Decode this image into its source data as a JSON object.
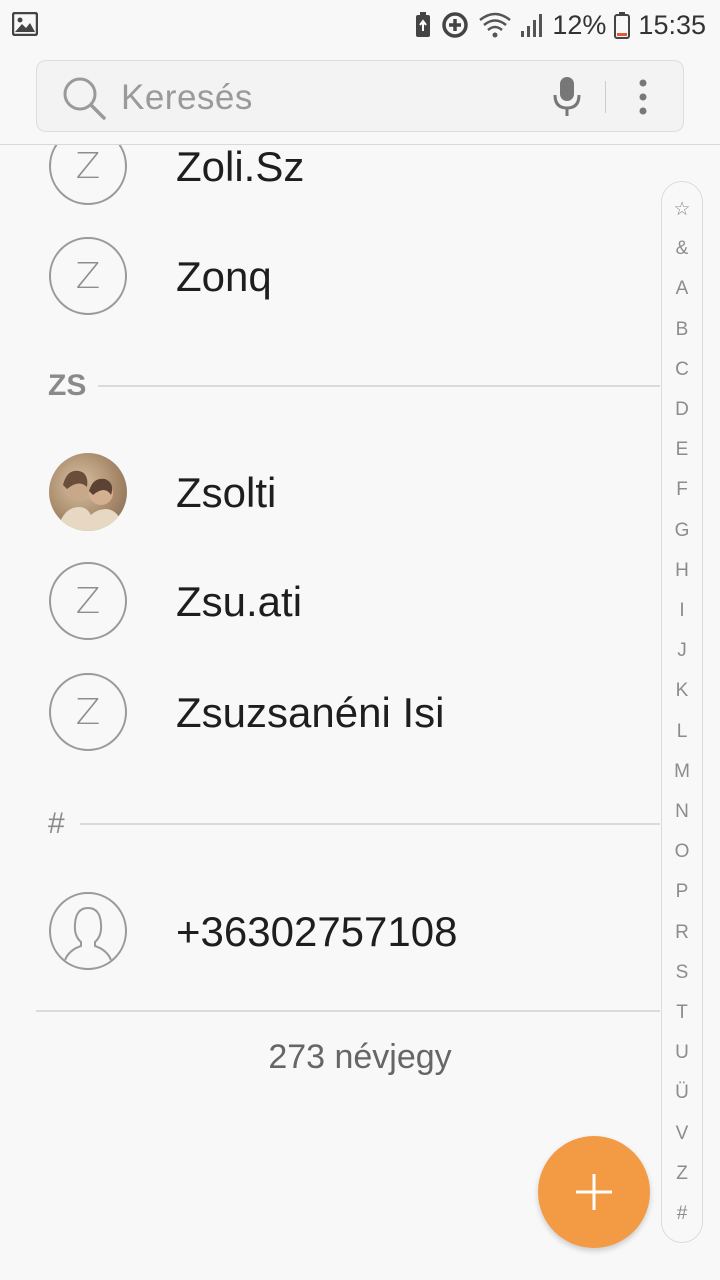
{
  "status_bar": {
    "battery_percent": "12%",
    "time": "15:35",
    "icons": [
      "gallery-icon",
      "battery-saver-icon",
      "data-saver-icon",
      "wifi-icon",
      "signal-icon",
      "battery-icon"
    ]
  },
  "search": {
    "placeholder": "Keresés",
    "icons": [
      "search-icon",
      "mic-icon",
      "more-vert-icon"
    ]
  },
  "contacts": [
    {
      "name": "Zoli.Sz",
      "initial": "Z"
    },
    {
      "name": "Zonq",
      "initial": "Z"
    },
    {
      "section": "ZS"
    },
    {
      "name": "Zsolti",
      "photo": true
    },
    {
      "name": "Zsu.ati",
      "initial": "Z"
    },
    {
      "name": "Zsuzsanéni Isi",
      "initial": "Z"
    },
    {
      "section": "#"
    },
    {
      "name": "+36302757108",
      "default_avatar": true
    }
  ],
  "footer": {
    "count_label": "273 névjegy"
  },
  "index": [
    "☆",
    "&",
    "A",
    "B",
    "C",
    "D",
    "E",
    "F",
    "G",
    "H",
    "I",
    "J",
    "K",
    "L",
    "M",
    "N",
    "O",
    "P",
    "R",
    "S",
    "T",
    "U",
    "Ü",
    "V",
    "Z",
    "#"
  ],
  "fab": {
    "icon": "plus-icon",
    "color": "#f39a45"
  }
}
